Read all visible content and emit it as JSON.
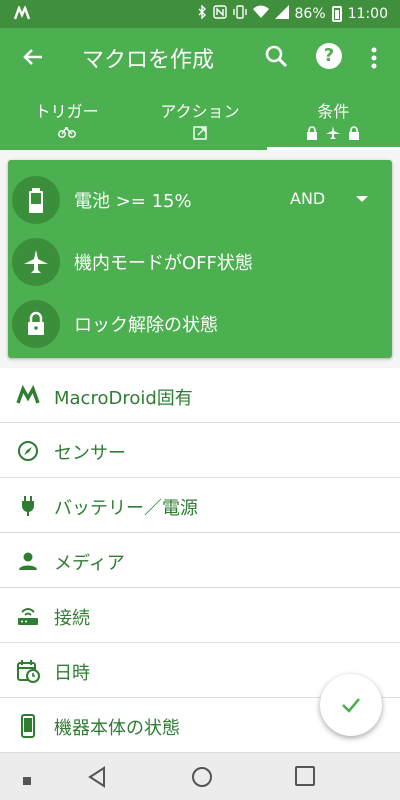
{
  "status_bar": {
    "battery_percent": "86%",
    "time": "11:00",
    "icons": [
      "macrodroid-icon",
      "bluetooth-icon",
      "nfc-icon",
      "vibrate-icon",
      "wifi-icon",
      "signal-icon",
      "battery-icon"
    ]
  },
  "app_bar": {
    "title": "マクロを作成"
  },
  "tabs": [
    {
      "label": "トリガー",
      "icons": [
        "bicycle-icon"
      ]
    },
    {
      "label": "アクション",
      "icons": [
        "launch-icon"
      ]
    },
    {
      "label": "条件",
      "icons": [
        "lock-icon",
        "airplane-icon",
        "lock-icon"
      ],
      "active": true
    }
  ],
  "conditions": {
    "items": [
      {
        "label": "電池 >= 15%",
        "icon": "battery-icon"
      },
      {
        "label": "機内モードがOFF状態",
        "icon": "airplane-icon"
      },
      {
        "label": "ロック解除の状態",
        "icon": "lock-icon"
      }
    ],
    "operator": "AND"
  },
  "categories": [
    {
      "label": "MacroDroid固有",
      "icon": "macrodroid-icon"
    },
    {
      "label": "センサー",
      "icon": "compass-icon"
    },
    {
      "label": "バッテリー／電源",
      "icon": "power-plug-icon"
    },
    {
      "label": "メディア",
      "icon": "person-icon"
    },
    {
      "label": "接続",
      "icon": "router-icon"
    },
    {
      "label": "日時",
      "icon": "calendar-clock-icon"
    },
    {
      "label": "機器本体の状態",
      "icon": "phone-icon"
    }
  ],
  "colors": {
    "primary": "#4caf50",
    "primary_dark": "#3f8f3c",
    "list_text": "#2e7d32"
  }
}
